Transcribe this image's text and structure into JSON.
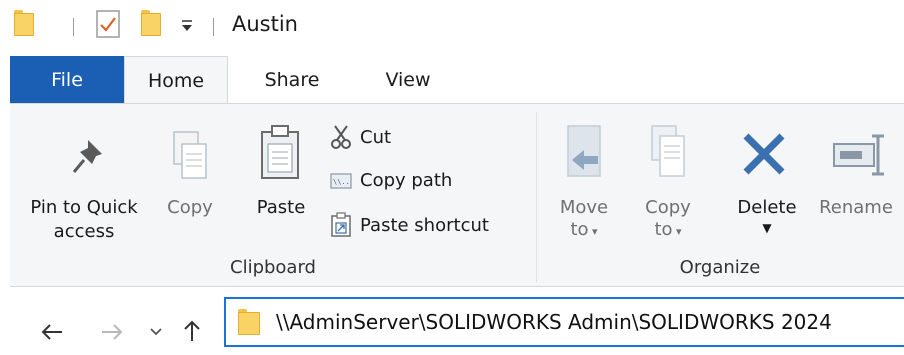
{
  "window": {
    "title": "Austin"
  },
  "tabs": [
    {
      "label": "File"
    },
    {
      "label": "Home"
    },
    {
      "label": "Share"
    },
    {
      "label": "View"
    }
  ],
  "ribbon": {
    "clipboard": {
      "group_label": "Clipboard",
      "pin_label_line1": "Pin to Quick",
      "pin_label_line2": "access",
      "copy_label": "Copy",
      "paste_label": "Paste",
      "cut_label": "Cut",
      "copy_path_label": "Copy path",
      "paste_shortcut_label": "Paste shortcut"
    },
    "organize": {
      "group_label": "Organize",
      "move_to_line1": "Move",
      "move_to_line2": "to",
      "copy_to_line1": "Copy",
      "copy_to_line2": "to",
      "delete_label": "Delete",
      "rename_label": "Rename"
    }
  },
  "navigation": {
    "address": "\\\\AdminServer\\SOLIDWORKS Admin\\SOLIDWORKS 2024"
  },
  "icons": {
    "back": "arrow-left-icon",
    "forward": "arrow-right-icon",
    "recent": "chevron-down-icon",
    "up": "arrow-up-icon"
  },
  "colors": {
    "file_tab": "#1a5fb4",
    "address_border": "#1a73d9",
    "folder": "#f9d366",
    "delete_x": "#3a6fb0"
  }
}
